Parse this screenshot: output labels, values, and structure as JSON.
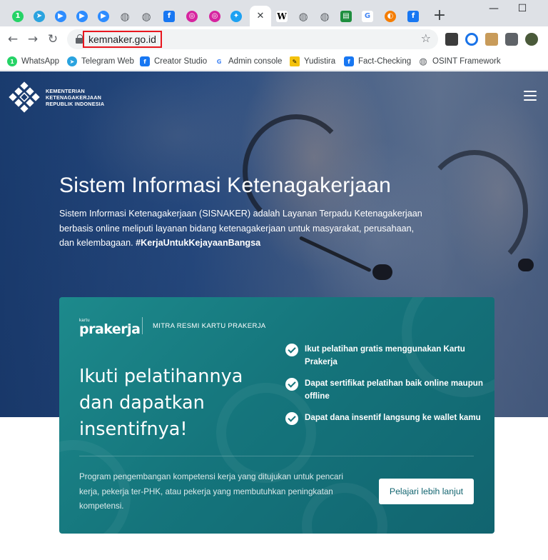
{
  "browser": {
    "tabs": [
      {
        "icon": "whatsapp-icon",
        "glyph": "1",
        "color": "#25d366"
      },
      {
        "icon": "telegram-icon",
        "glyph": "➤",
        "color": "#2aa3df"
      },
      {
        "icon": "zoom-icon",
        "glyph": "▶",
        "color": "#2d8cff"
      },
      {
        "icon": "zoom-icon",
        "glyph": "▶",
        "color": "#2d8cff"
      },
      {
        "icon": "zoom-icon",
        "glyph": "▶",
        "color": "#2d8cff"
      },
      {
        "icon": "globe-icon",
        "glyph": "◍",
        "color": "#5f6368"
      },
      {
        "icon": "globe-icon",
        "glyph": "◍",
        "color": "#5f6368"
      },
      {
        "icon": "facebook-icon",
        "glyph": "f",
        "color": "#1877f2"
      },
      {
        "icon": "instagram-icon",
        "glyph": "◎",
        "color": "#d6249f"
      },
      {
        "icon": "instagram-icon",
        "glyph": "◎",
        "color": "#d6249f"
      },
      {
        "icon": "twitter-icon",
        "glyph": "✦",
        "color": "#1da1f2"
      },
      {
        "icon": "close-icon",
        "glyph": "✕",
        "color": "#3c4043"
      },
      {
        "icon": "wikipedia-icon",
        "glyph": "W",
        "color": "#ffffff"
      },
      {
        "icon": "globe-icon",
        "glyph": "◍",
        "color": "#5f6368"
      },
      {
        "icon": "globe-icon",
        "glyph": "◍",
        "color": "#5f6368"
      },
      {
        "icon": "document-icon",
        "glyph": "▤",
        "color": "#1e8e3e"
      },
      {
        "icon": "google-icon",
        "glyph": "G",
        "color": "#ffffff"
      },
      {
        "icon": "blogger-icon",
        "glyph": "◐",
        "color": "#f57d00"
      },
      {
        "icon": "facebook-icon",
        "glyph": "f",
        "color": "#1877f2"
      }
    ],
    "new_tab_glyph": "+",
    "minimize_glyph": "—",
    "maximize_glyph": "☐",
    "back_glyph": "←",
    "forward_glyph": "→",
    "reload_glyph": "↻",
    "url": "kemnaker.go.id",
    "bookmark_star_glyph": "☆",
    "bookmarks": [
      {
        "label": "WhatsApp",
        "icon": "whatsapp-icon",
        "glyph": "1",
        "color": "#25d366"
      },
      {
        "label": "Telegram Web",
        "icon": "telegram-icon",
        "glyph": "➤",
        "color": "#2aa3df"
      },
      {
        "label": "Creator Studio",
        "icon": "facebook-icon",
        "glyph": "f",
        "color": "#1877f2"
      },
      {
        "label": "Admin console",
        "icon": "google-icon",
        "glyph": "G",
        "color": "#ffffff"
      },
      {
        "label": "Yudistira",
        "icon": "pen-icon",
        "glyph": "✎",
        "color": "#f4c20d"
      },
      {
        "label": "Fact-Checking",
        "icon": "facebook-icon",
        "glyph": "f",
        "color": "#1877f2"
      },
      {
        "label": "OSINT Framework",
        "icon": "globe-icon",
        "glyph": "◍",
        "color": "#5f6368"
      }
    ]
  },
  "site": {
    "logo_lines": [
      "KEMENTERIAN",
      "KETENAGAKERJAAN",
      "REPUBLIK INDONESIA"
    ],
    "hero_title": "Sistem Informasi Ketenagakerjaan",
    "hero_desc": "Sistem Informasi Ketenagakerjaan (SISNAKER) adalah Layanan Terpadu Ketenagakerjaan berbasis online meliputi layanan bidang ketenagakerjaan untuk masyarakat, perusahaan, dan kelembagaan.",
    "hero_hashtag": "#KerjaUntukKejayaanBangsa",
    "card": {
      "logo_small": "kartu",
      "logo_big": "prakerja",
      "mitra": "MITRA RESMI KARTU PRAKERJA",
      "title": "Ikuti pelatihannya dan dapatkan insentifnya!",
      "bullets": [
        "Ikut pelatihan gratis menggunakan Kartu Prakerja",
        "Dapat sertifikat pelatihan baik online maupun offline",
        "Dapat dana insentif langsung ke wallet kamu"
      ],
      "footer": "Program pengembangan kompetensi kerja yang ditujukan untuk pencari kerja, pekerja ter-PHK, atau pekerja yang membutuhkan peningkatan kompetensi.",
      "cta": "Pelajari lebih lanjut"
    }
  }
}
